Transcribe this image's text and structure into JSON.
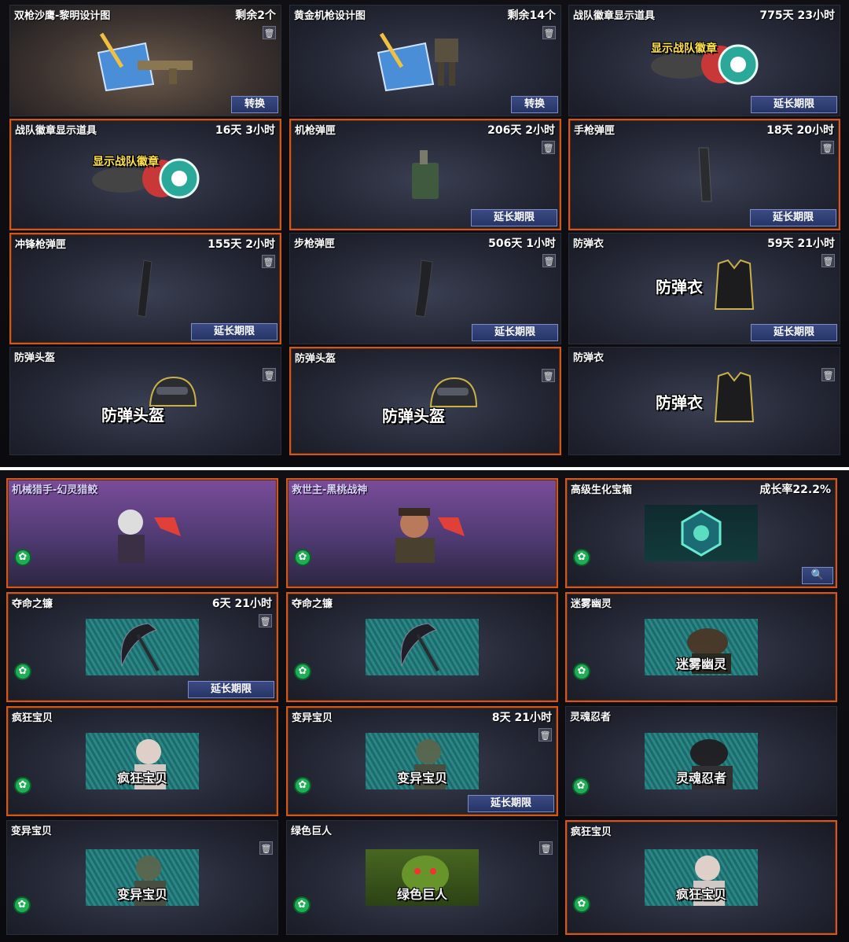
{
  "top_panel": {
    "cards": [
      {
        "name": "双枪沙鹰-黎明设计图",
        "status": "剩余2个",
        "button": "转换",
        "trash": true
      },
      {
        "name": "黄金机枪设计图",
        "status": "剩余14个",
        "button": "转换",
        "trash": true
      },
      {
        "name": "战队徽章显示道具",
        "status": "775天 23小时",
        "button": "延长期限",
        "art_text": "显示战队徽章"
      },
      {
        "name": "战队徽章显示道具",
        "status": "16天 3小时",
        "art_text": "显示战队徽章"
      },
      {
        "name": "机枪弹匣",
        "status": "206天 2小时",
        "button": "延长期限",
        "trash": true
      },
      {
        "name": "手枪弹匣",
        "status": "18天 20小时",
        "button": "延长期限",
        "trash": true
      },
      {
        "name": "冲锋枪弹匣",
        "status": "155天 2小时",
        "button": "延长期限",
        "trash": true
      },
      {
        "name": "步枪弹匣",
        "status": "506天 1小时",
        "button": "延长期限",
        "trash": true
      },
      {
        "name": "防弹衣",
        "status": "59天 21小时",
        "button": "延长期限",
        "trash": true,
        "art_text": "防弹衣"
      },
      {
        "name": "防弹头盔",
        "trash": true,
        "art_text": "防弹头盔"
      },
      {
        "name": "防弹头盔",
        "trash": true,
        "art_text": "防弹头盔"
      },
      {
        "name": "防弹衣",
        "trash": true,
        "art_text": "防弹衣"
      }
    ]
  },
  "bottom_panel": {
    "cards": [
      {
        "name": "机械猎手-幻灵猎鲛"
      },
      {
        "name": "救世主-黑桃战神"
      },
      {
        "name": "高级生化宝箱",
        "status": "成长率22.2%",
        "button": "🔍"
      },
      {
        "name": "夺命之镰",
        "status": "6天 21小时",
        "button": "延长期限",
        "trash": true
      },
      {
        "name": "夺命之镰"
      },
      {
        "name": "迷雾幽灵",
        "art_text": "迷雾幽灵"
      },
      {
        "name": "疯狂宝贝",
        "art_text": "疯狂宝贝"
      },
      {
        "name": "变异宝贝",
        "status": "8天 21小时",
        "button": "延长期限",
        "trash": true,
        "art_text": "变异宝贝"
      },
      {
        "name": "灵魂忍者",
        "art_text": "灵魂忍者"
      },
      {
        "name": "变异宝贝",
        "trash": true,
        "art_text": "变异宝贝"
      },
      {
        "name": "绿色巨人",
        "trash": true,
        "art_text": "绿色巨人"
      },
      {
        "name": "疯狂宝贝",
        "art_text": "疯狂宝贝"
      }
    ]
  },
  "icons": {
    "trash": "trash-icon",
    "zombie_badge": "zombie-badge-icon",
    "search": "magnifier-icon"
  },
  "colors": {
    "selected_border": "#d2571d",
    "button_bg": "#263566",
    "card_bg": "#252836",
    "zombie_badge": "#1fae55"
  }
}
